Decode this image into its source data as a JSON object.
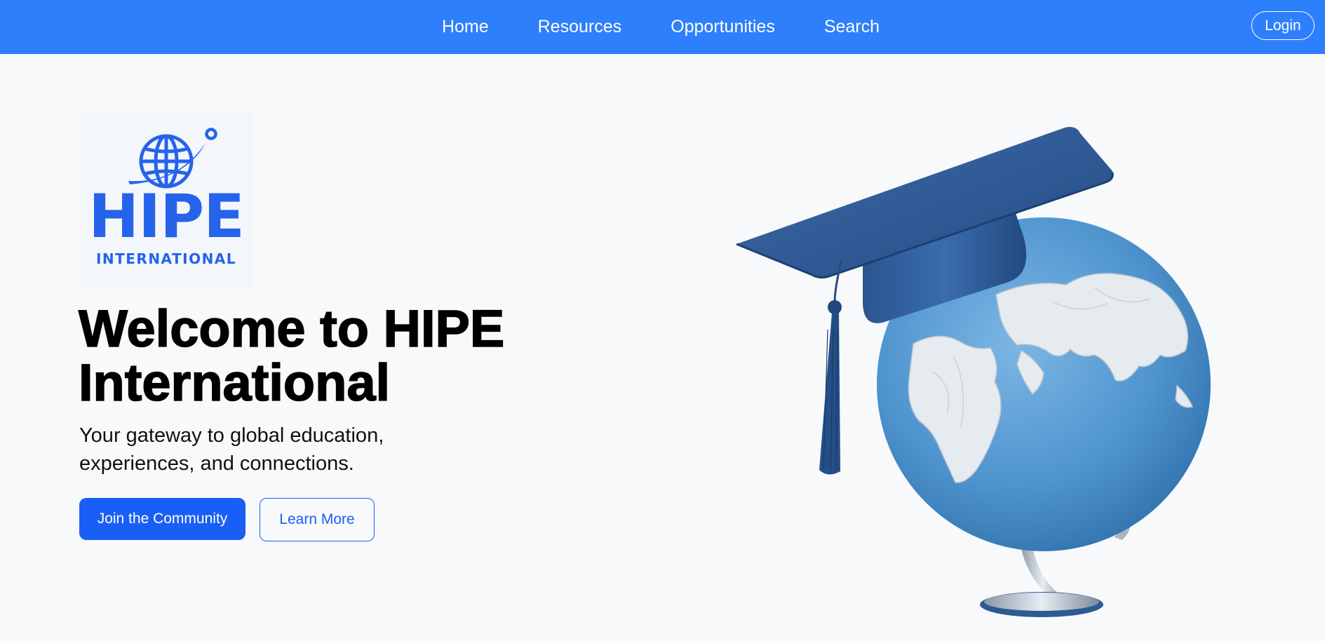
{
  "nav": {
    "links": [
      "Home",
      "Resources",
      "Opportunities",
      "Search"
    ],
    "login_label": "Login"
  },
  "logo": {
    "name": "HIPE",
    "subtitle": "INTERNATIONAL",
    "icon": "globe-with-orbit-icon"
  },
  "hero": {
    "title": "Welcome to HIPE International",
    "subtitle": "Your gateway to global education, experiences, and connections.",
    "primary_button": "Join the Community",
    "secondary_button": "Learn More",
    "image": "graduation-cap-on-globe-illustration"
  },
  "colors": {
    "nav_background": "#2e7ffb",
    "accent": "#1a5ff5",
    "logo_blue": "#2563eb",
    "page_background": "#f7f9fb"
  }
}
